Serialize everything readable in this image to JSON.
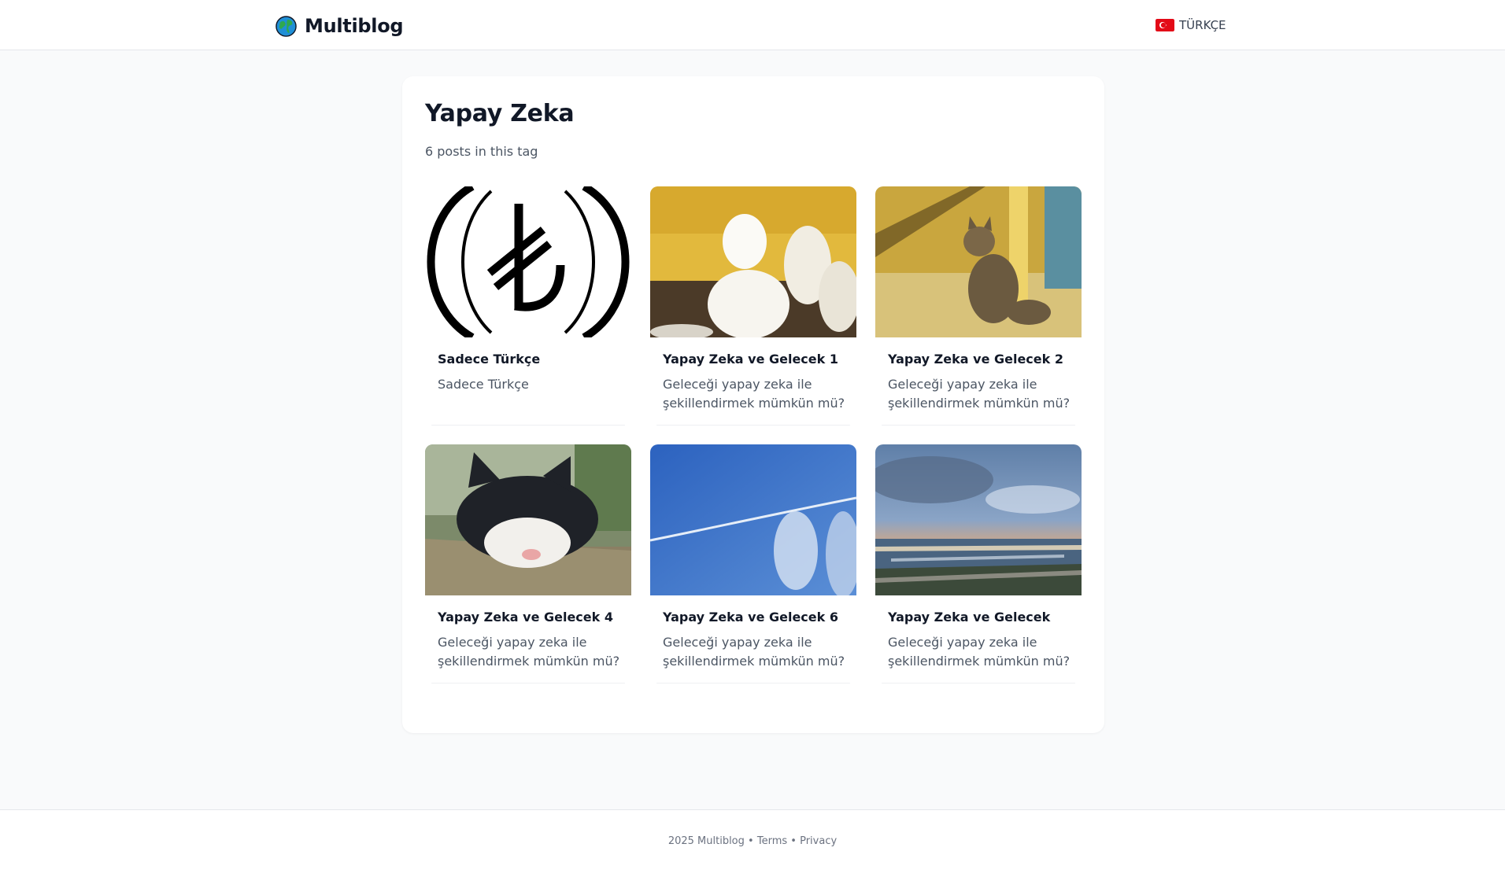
{
  "header": {
    "brand": "Multiblog",
    "brand_icon": "globe-icon",
    "language_label": "TÜRKÇE",
    "language_flag": "turkey-flag-icon"
  },
  "tag_page": {
    "title": "Yapay Zeka",
    "subtitle": "6 posts in this tag"
  },
  "posts": [
    {
      "title": "Sadece Türkçe",
      "excerpt": "Sadece Türkçe",
      "image": "turkish-lira-logo"
    },
    {
      "title": "Yapay Zeka ve Gelecek 1",
      "excerpt": "Geleceği yapay zeka ile şekillendirmek mümkün mü?",
      "image": "white-chickens-photo"
    },
    {
      "title": "Yapay Zeka ve Gelecek 2",
      "excerpt": "Geleceği yapay zeka ile şekillendirmek mümkün mü?",
      "image": "tabby-cat-photo"
    },
    {
      "title": "Yapay Zeka ve Gelecek 4",
      "excerpt": "Geleceği yapay zeka ile şekillendirmek mümkün mü?",
      "image": "sleeping-cat-photo"
    },
    {
      "title": "Yapay Zeka ve Gelecek 6",
      "excerpt": "Geleceği yapay zeka ile şekillendirmek mümkün mü?",
      "image": "blue-sky-contrail-photo"
    },
    {
      "title": "Yapay Zeka ve Gelecek",
      "excerpt": "Geleceği yapay zeka ile şekillendirmek mümkün mü?",
      "image": "sea-sunset-photo"
    }
  ],
  "footer": {
    "copyright": "2025 Multiblog",
    "separator": "•",
    "terms": "Terms",
    "privacy": "Privacy"
  },
  "colors": {
    "page_bg": "#f9fafb",
    "card_bg": "#ffffff",
    "text_primary": "#111827",
    "text_secondary": "#4b5563",
    "border": "#e5e7eb"
  }
}
